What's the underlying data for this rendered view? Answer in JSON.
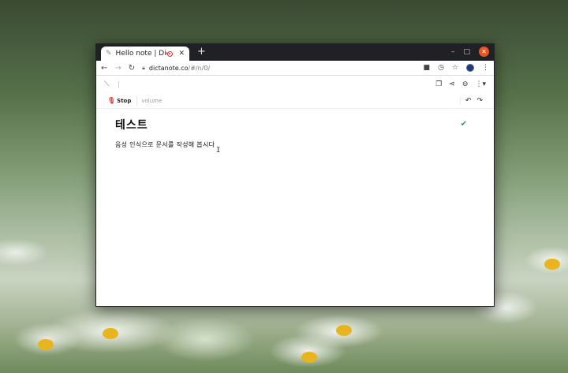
{
  "browser": {
    "tab_title": "Hello note | Dictanote",
    "tab_close": "✕",
    "new_tab": "+",
    "url_host": "dictanote.co",
    "url_path": "/#/n/0/"
  },
  "window_controls": {
    "minimize": "–",
    "maximize": "□",
    "close": "✕"
  },
  "app": {
    "dictation_label": "Stop",
    "volume_placeholder": "volume"
  },
  "note": {
    "title": "테스트",
    "body": "음성 인식으로 문서를 작성해 봅시다"
  },
  "colors": {
    "accent_close": "#e95420",
    "saved_check": "#2e9d5b",
    "mic_active": "#e3342f"
  }
}
